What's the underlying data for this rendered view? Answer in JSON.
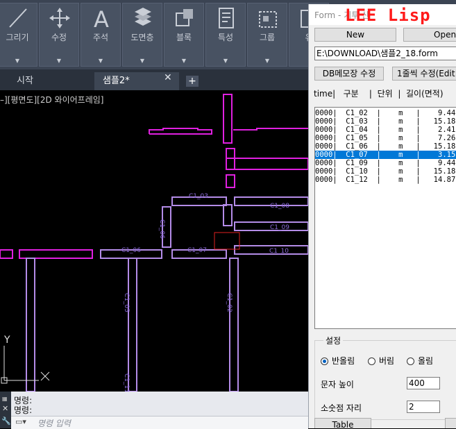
{
  "ribbon": {
    "buttons": [
      {
        "label": "그리기",
        "icon": "line-draw-icon"
      },
      {
        "label": "수정",
        "icon": "move-arrows-icon"
      },
      {
        "label": "주석",
        "icon": "text-a-icon"
      },
      {
        "label": "도면층",
        "icon": "layers-icon"
      },
      {
        "label": "블록",
        "icon": "block-icon"
      },
      {
        "label": "특성",
        "icon": "properties-icon"
      },
      {
        "label": "그룹",
        "icon": "group-icon"
      },
      {
        "label": "유",
        "icon": "utilities-icon"
      }
    ],
    "arrow": "▼"
  },
  "tabs": {
    "start": "시작",
    "active": "샘플2*",
    "close": "✕",
    "add": "+"
  },
  "viewport": {
    "label": "–][평면도][2D 와이어프레임]"
  },
  "command": {
    "line1": "명령:",
    "line2": "명령:",
    "prompt": "명령 입력"
  },
  "form": {
    "title": "Form - 기투 산",
    "brand": "LEE Lisp",
    "new_label": "New",
    "open_label": "Open",
    "path": "E:\\DOWNLOAD\\샘플2_18.form",
    "db_memo_label": "DB메모장 수정",
    "line_edit_label": "1줄씩 수정(Edit",
    "header": "time|   구분    |  단위  |  길이(면적)",
    "rows": [
      {
        "text": "0000|  C1_02  |    m   |    9.44  |",
        "selected": false
      },
      {
        "text": "0000|  C1_03  |    m   |   15.18  |",
        "selected": false
      },
      {
        "text": "0000|  C1_04  |    m   |    2.41  |",
        "selected": false
      },
      {
        "text": "0000|  C1_05  |    m   |    7.26  |",
        "selected": false
      },
      {
        "text": "0000|  C1_06  |    m   |   15.18  |",
        "selected": false
      },
      {
        "text": "0000|  C1_07  |    m   |    3.15  |",
        "selected": true
      },
      {
        "text": "0000|  C1_09  |    m   |    9.44  |",
        "selected": false
      },
      {
        "text": "0000|  C1_10  |    m   |   15.18  |",
        "selected": false
      },
      {
        "text": "0000|  C1_12  |    m   |   14.87  |",
        "selected": false
      }
    ],
    "settings": {
      "legend": "설정",
      "round_half": "반올림",
      "round_down": "버림",
      "round_up": "올림",
      "text_height_label": "문자 높이",
      "text_height_value": "400",
      "decimal_label": "소숫점 자리",
      "decimal_value": "2"
    },
    "table_label": "Table"
  },
  "canvas": {
    "labels": [
      "C1_03",
      "C1_08",
      "C1_09",
      "C1_06",
      "C1_10",
      "C1_07",
      "C1_06",
      "C1_05",
      "C1_02",
      "C1_11"
    ],
    "axis_y": "Y",
    "colors": {
      "magenta": "#e020e0",
      "violet": "#b48ce8",
      "red": "#e02020"
    }
  }
}
